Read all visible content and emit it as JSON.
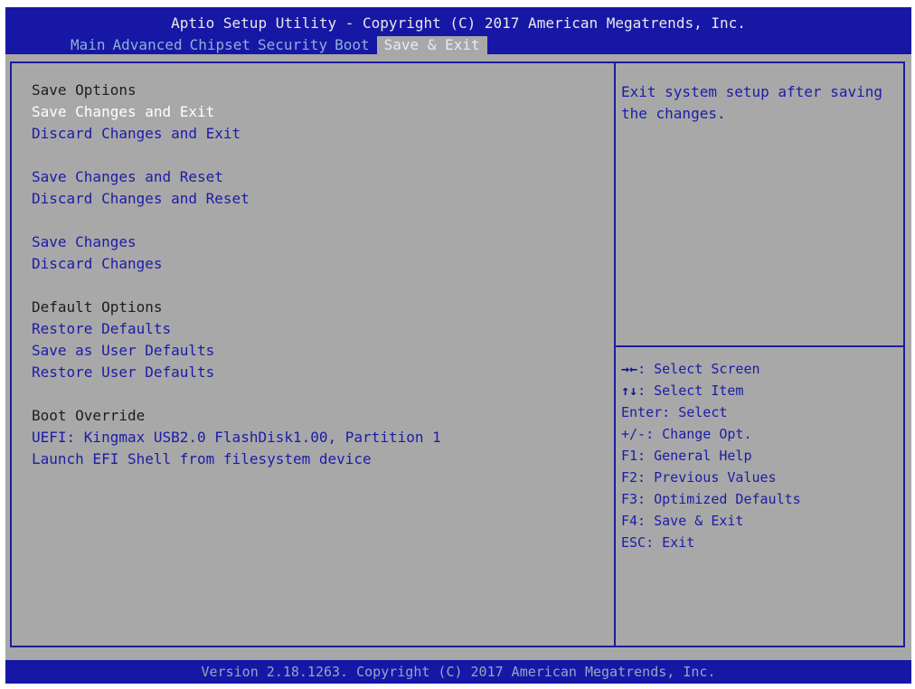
{
  "header": {
    "title": "Aptio Setup Utility - Copyright (C) 2017 American Megatrends, Inc.",
    "tabs": [
      {
        "label": "Main"
      },
      {
        "label": "Advanced"
      },
      {
        "label": "Chipset"
      },
      {
        "label": "Security"
      },
      {
        "label": "Boot"
      },
      {
        "label": "Save & Exit",
        "active": true
      }
    ]
  },
  "menu": {
    "save_options_heading": "Save Options",
    "items": [
      {
        "label": "Save Changes and Exit",
        "selected": true
      },
      {
        "label": "Discard Changes and Exit"
      },
      {
        "label": "Save Changes and Reset"
      },
      {
        "label": "Discard Changes and Reset"
      },
      {
        "label": "Save Changes"
      },
      {
        "label": "Discard Changes"
      }
    ],
    "default_options_heading": "Default Options",
    "default_items": [
      {
        "label": "Restore Defaults"
      },
      {
        "label": "Save as User Defaults"
      },
      {
        "label": "Restore User Defaults"
      }
    ],
    "boot_override_heading": "Boot Override",
    "boot_items": [
      {
        "label": "UEFI: Kingmax USB2.0 FlashDisk1.00, Partition 1"
      },
      {
        "label": "Launch EFI Shell from filesystem device"
      }
    ]
  },
  "help": {
    "text": "Exit system setup after saving the changes."
  },
  "keys": [
    {
      "sym": "→←",
      "text": ": Select Screen"
    },
    {
      "sym": "↑↓",
      "text": ": Select Item"
    },
    {
      "sym": "",
      "text": "Enter: Select"
    },
    {
      "sym": "",
      "text": "+/-: Change Opt."
    },
    {
      "sym": "",
      "text": "F1: General Help"
    },
    {
      "sym": "",
      "text": "F2: Previous Values"
    },
    {
      "sym": "",
      "text": "F3: Optimized Defaults"
    },
    {
      "sym": "",
      "text": "F4: Save & Exit"
    },
    {
      "sym": "",
      "text": "ESC: Exit"
    }
  ],
  "footer": {
    "text": "Version 2.18.1263. Copyright (C) 2017 American Megatrends, Inc."
  },
  "colors": {
    "header_bg": "#1717a6",
    "panel_bg": "#a8a8a8",
    "item_text": "#1c1ca8",
    "selected_text": "#ffffff"
  }
}
